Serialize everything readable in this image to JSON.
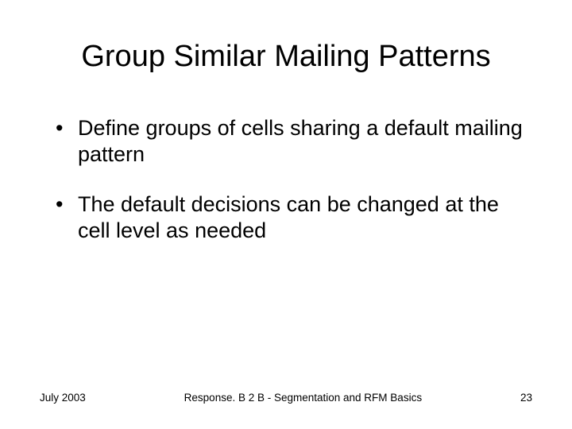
{
  "title": "Group Similar Mailing Patterns",
  "bullets": [
    "Define groups of cells sharing a default mailing pattern",
    "The default decisions can be changed at the cell level as needed"
  ],
  "footer": {
    "date": "July 2003",
    "center": "Response. B 2 B - Segmentation and RFM Basics",
    "page": "23"
  }
}
